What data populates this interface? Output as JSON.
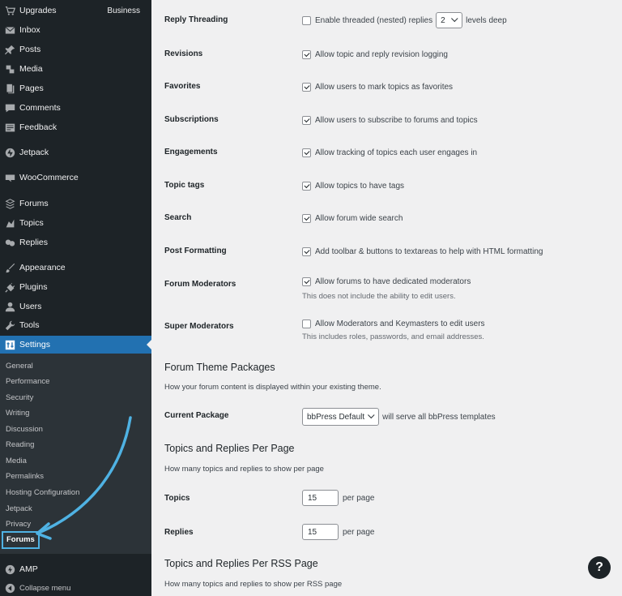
{
  "sidebar": {
    "items": [
      {
        "label": "Upgrades",
        "icon": "cart-icon",
        "extra": "Business"
      },
      {
        "label": "Inbox",
        "icon": "envelope-icon"
      },
      {
        "label": "Posts",
        "icon": "pin-icon"
      },
      {
        "label": "Media",
        "icon": "media-icon"
      },
      {
        "label": "Pages",
        "icon": "pages-icon"
      },
      {
        "label": "Comments",
        "icon": "comment-icon"
      },
      {
        "label": "Feedback",
        "icon": "feedback-icon"
      },
      {
        "label": "Jetpack",
        "icon": "jetpack-icon"
      },
      {
        "label": "WooCommerce",
        "icon": "woo-icon"
      },
      {
        "label": "Forums",
        "icon": "forums-icon"
      },
      {
        "label": "Topics",
        "icon": "topics-icon"
      },
      {
        "label": "Replies",
        "icon": "replies-icon"
      },
      {
        "label": "Appearance",
        "icon": "brush-icon"
      },
      {
        "label": "Plugins",
        "icon": "plug-icon"
      },
      {
        "label": "Users",
        "icon": "user-icon"
      },
      {
        "label": "Tools",
        "icon": "wrench-icon"
      },
      {
        "label": "Settings",
        "icon": "settings-icon"
      }
    ],
    "submenu": [
      "General",
      "Performance",
      "Security",
      "Writing",
      "Discussion",
      "Reading",
      "Media",
      "Permalinks",
      "Hosting Configuration",
      "Jetpack",
      "Privacy"
    ],
    "submenu_current": "Forums",
    "amp_label": "AMP",
    "collapse_label": "Collapse menu",
    "accent_color": "#2271b1",
    "highlight_color": "#4fb2e3"
  },
  "settings": {
    "reply_threading": {
      "label": "Reply Threading",
      "text": "Enable threaded (nested) replies",
      "depth": "2",
      "suffix": "levels deep"
    },
    "revisions": {
      "label": "Revisions",
      "text": "Allow topic and reply revision logging"
    },
    "favorites": {
      "label": "Favorites",
      "text": "Allow users to mark topics as favorites"
    },
    "subscriptions": {
      "label": "Subscriptions",
      "text": "Allow users to subscribe to forums and topics"
    },
    "engagements": {
      "label": "Engagements",
      "text": "Allow tracking of topics each user engages in"
    },
    "topic_tags": {
      "label": "Topic tags",
      "text": "Allow topics to have tags"
    },
    "search": {
      "label": "Search",
      "text": "Allow forum wide search"
    },
    "post_formatting": {
      "label": "Post Formatting",
      "text": "Add toolbar & buttons to textareas to help with HTML formatting"
    },
    "forum_moderators": {
      "label": "Forum Moderators",
      "text": "Allow forums to have dedicated moderators",
      "desc": "This does not include the ability to edit users."
    },
    "super_moderators": {
      "label": "Super Moderators",
      "text": "Allow Moderators and Keymasters to edit users",
      "desc": "This includes roles, passwords, and email addresses."
    }
  },
  "theme_packages": {
    "title": "Forum Theme Packages",
    "desc": "How your forum content is displayed within your existing theme.",
    "current_label": "Current Package",
    "current_value": "bbPress Default",
    "suffix": "will serve all bbPress templates"
  },
  "per_page": {
    "title": "Topics and Replies Per Page",
    "desc": "How many topics and replies to show per page",
    "topics_label": "Topics",
    "topics_value": "15",
    "replies_label": "Replies",
    "replies_value": "15",
    "unit": "per page"
  },
  "per_rss": {
    "title": "Topics and Replies Per RSS Page",
    "desc": "How many topics and replies to show per RSS page"
  },
  "help": "?"
}
